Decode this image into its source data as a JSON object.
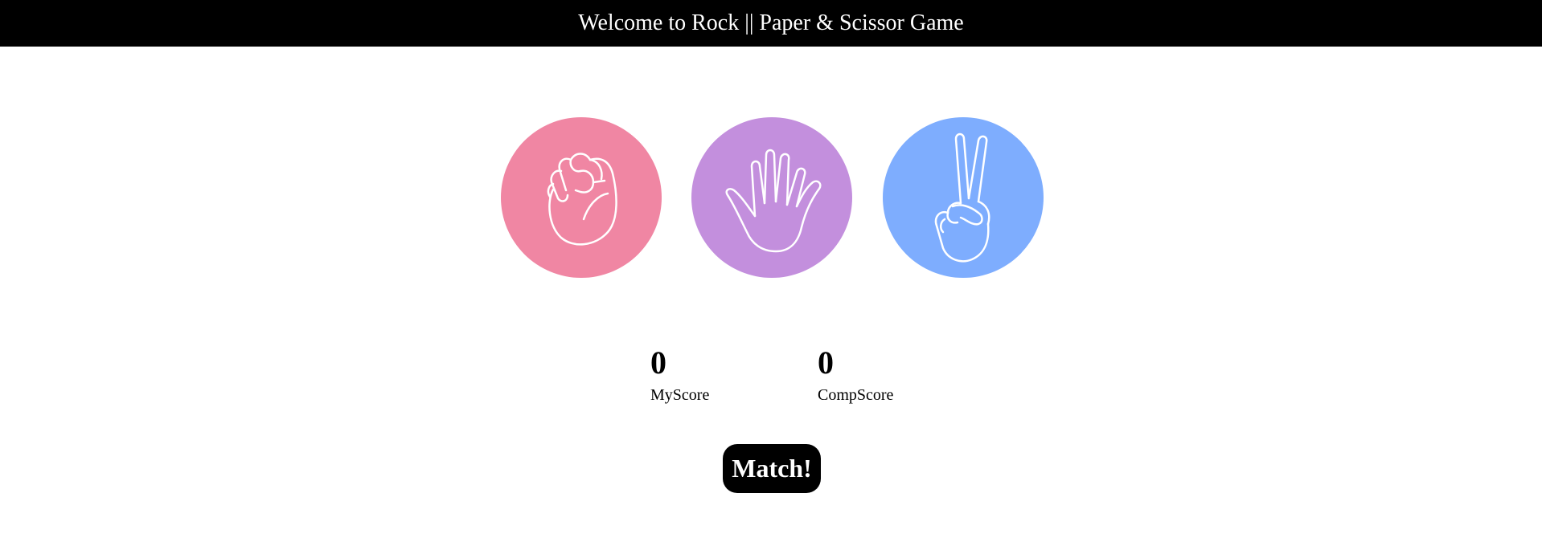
{
  "header": {
    "title": "Welcome to Rock || Paper & Scissor Game"
  },
  "choices": [
    {
      "id": "rock",
      "icon": "fist-icon",
      "color": "#f086a3"
    },
    {
      "id": "paper",
      "icon": "open-hand-icon",
      "color": "#c38fdd"
    },
    {
      "id": "scissor",
      "icon": "peace-hand-icon",
      "color": "#7eadfe"
    }
  ],
  "scores": {
    "my": {
      "value": "0",
      "label": "MyScore"
    },
    "comp": {
      "value": "0",
      "label": "CompScore"
    }
  },
  "match_button": {
    "label": "Match!"
  }
}
